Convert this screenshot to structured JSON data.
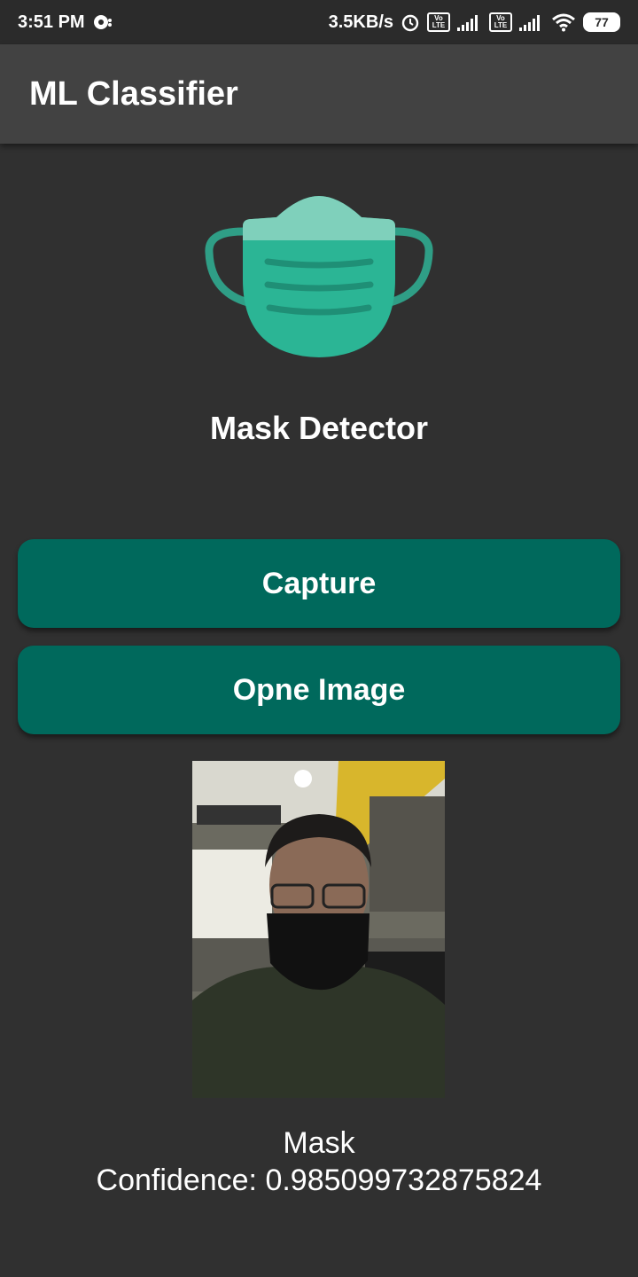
{
  "status_bar": {
    "time": "3:51 PM",
    "net_speed": "3.5KB/s",
    "volte1": "Vo LTE",
    "volte2": "Vo LTE",
    "battery": "77"
  },
  "app_bar": {
    "title": "ML Classifier"
  },
  "header": {
    "subtitle": "Mask Detector",
    "logo_icon": "face-mask-icon",
    "accent_color": "#2bb595"
  },
  "buttons": {
    "capture_label": "Capture",
    "open_label": "Opne Image",
    "color": "#00695c"
  },
  "result": {
    "label": "Mask",
    "confidence": "Confidence: 0.985099732875824"
  }
}
